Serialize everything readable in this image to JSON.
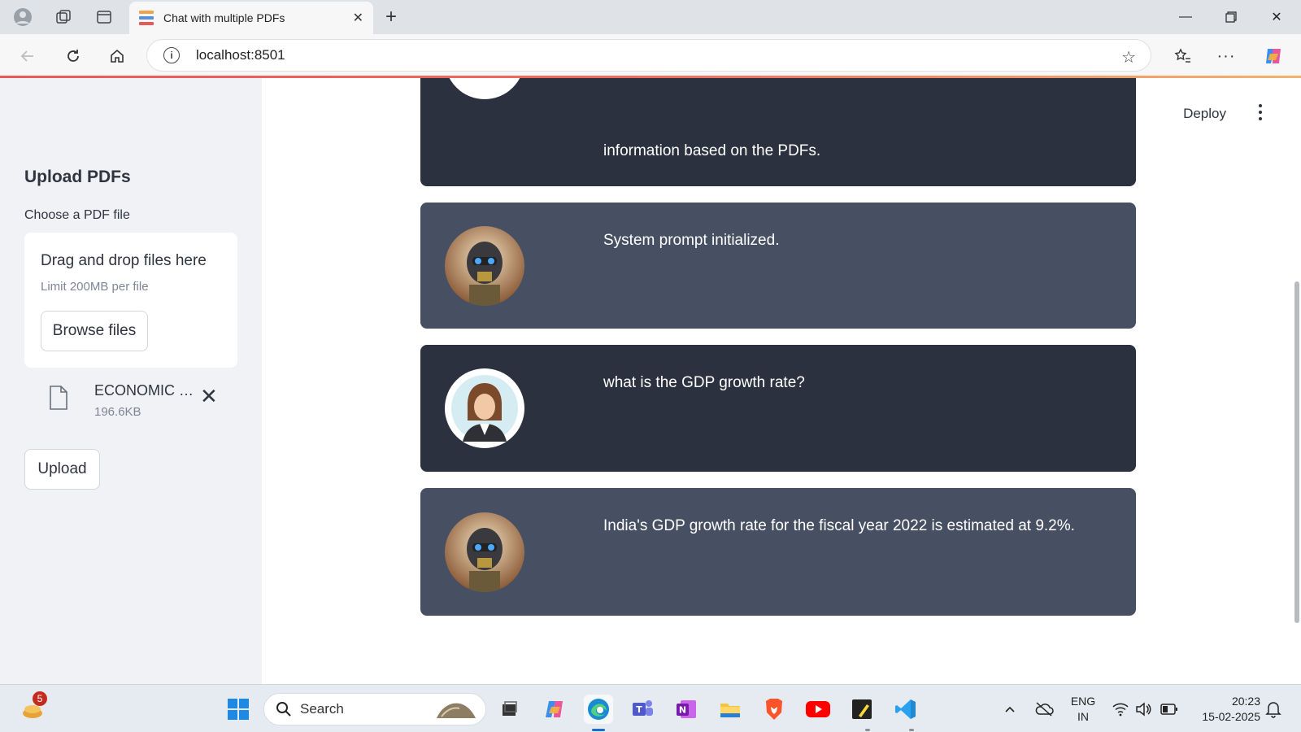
{
  "browser": {
    "tab_title": "Chat with multiple PDFs",
    "url": "localhost:8501"
  },
  "sidebar": {
    "title": "Upload PDFs",
    "uploader_label": "Choose a PDF file",
    "dropzone_title": "Drag and drop files here",
    "dropzone_limit": "Limit 200MB per file",
    "browse_label": "Browse files",
    "file": {
      "name": "ECONOMIC S...",
      "size": "196.6KB"
    },
    "upload_label": "Upload"
  },
  "header": {
    "deploy_label": "Deploy"
  },
  "chat": {
    "messages": [
      {
        "role": "bot",
        "text": "information based on the PDFs."
      },
      {
        "role": "bot",
        "text": "System prompt initialized."
      },
      {
        "role": "user",
        "text": "what is the GDP growth rate?"
      },
      {
        "role": "bot",
        "text": "India's GDP growth rate for the fiscal year 2022 is estimated at 9.2%."
      }
    ]
  },
  "taskbar": {
    "search_label": "Search",
    "notification_count": "5",
    "lang_line1": "ENG",
    "lang_line2": "IN",
    "time": "20:23",
    "date": "15-02-2025"
  },
  "colors": {
    "bot_bg": "#475063",
    "user_bg": "#2b313e",
    "sidebar_bg": "#f0f2f6",
    "accent": "#e85a5a"
  }
}
